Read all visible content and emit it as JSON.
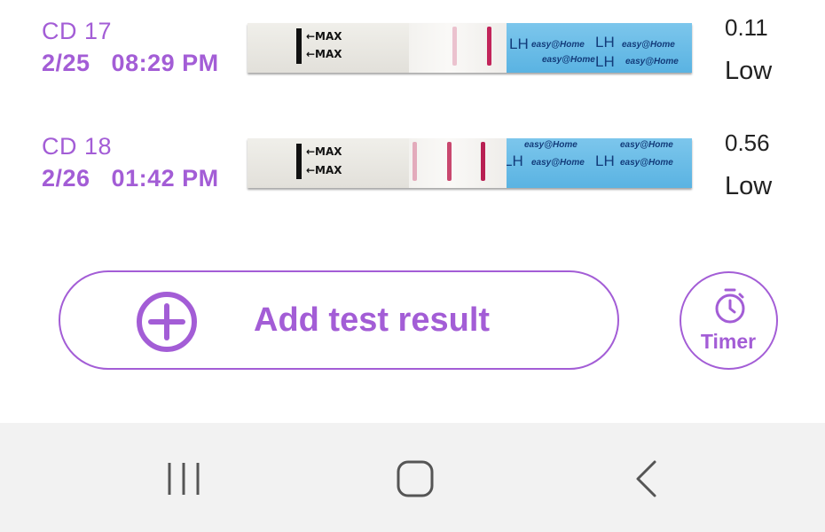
{
  "results": [
    {
      "cycle_day": "CD 17",
      "datetime": "2/25   08:29 PM",
      "value": "0.11",
      "level": "Low",
      "strip": {
        "max_label": "←MAX",
        "brand_text": "easy@Home",
        "lh_text": "LH"
      }
    },
    {
      "cycle_day": "CD 18",
      "datetime": "2/26   01:42 PM",
      "value": "0.56",
      "level": "Low",
      "strip": {
        "max_label": "←MAX",
        "brand_text": "easy@Home",
        "lh_text": "LH"
      }
    }
  ],
  "actions": {
    "add_label": "Add test result",
    "timer_label": "Timer"
  },
  "colors": {
    "accent": "#a35dd6",
    "text": "#222222",
    "strip_blue": "#6bbde8",
    "test_line": "#c2245a",
    "navbar_bg": "#f2f2f2"
  },
  "icons": {
    "add": "plus-circle-icon",
    "timer": "stopwatch-icon",
    "nav_recents": "recents-icon",
    "nav_home": "home-icon",
    "nav_back": "back-icon"
  }
}
